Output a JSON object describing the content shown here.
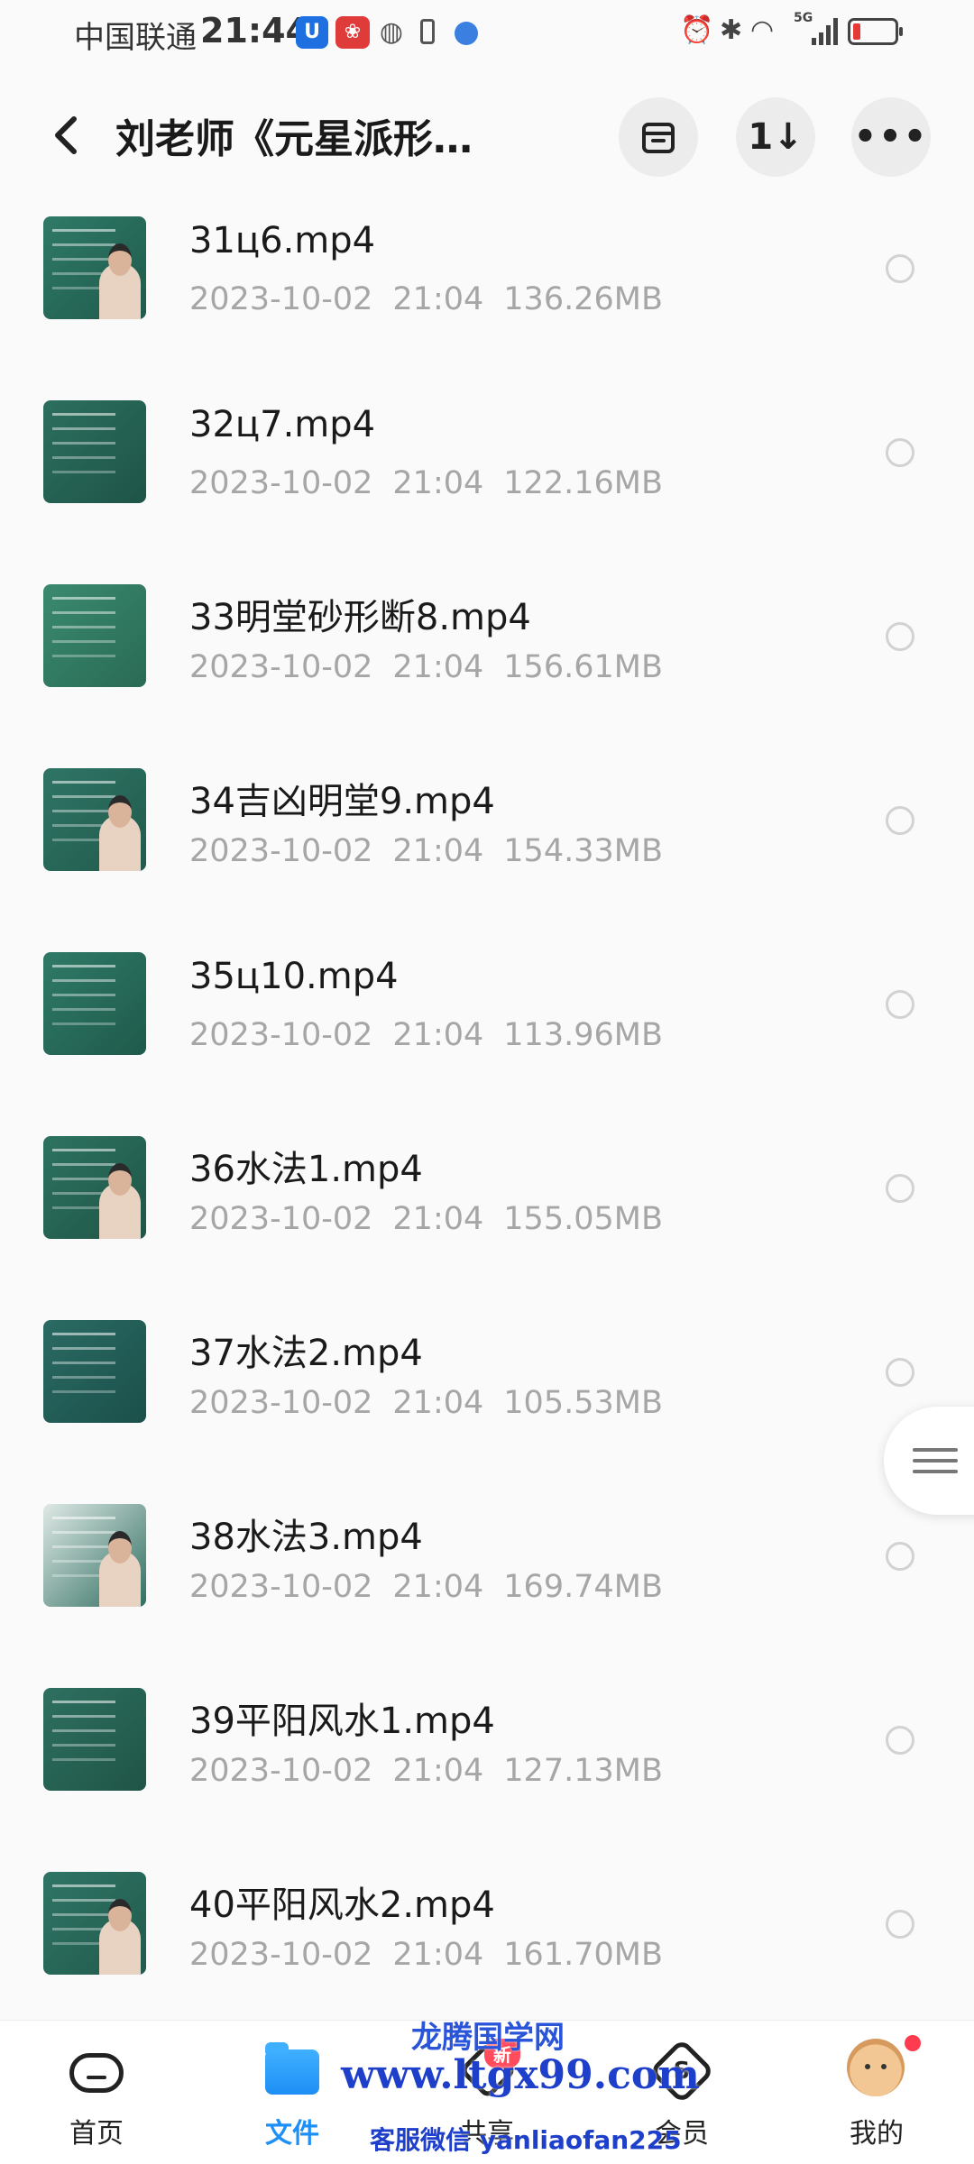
{
  "status_bar": {
    "carrier": "中国联通",
    "time": "21:44",
    "network": "5G",
    "battery_level": 0.15
  },
  "header": {
    "title": "刘老师《元星派形…",
    "back_icon": "chevron-left-icon",
    "actions": [
      "archive-icon",
      "sort-icon",
      "more-icon"
    ],
    "sort_label": "1↓",
    "more_label": "•••"
  },
  "files": [
    {
      "name": "31ц6.mp4",
      "date": "2023-10-02",
      "time": "21:04",
      "size": "136.26MB"
    },
    {
      "name": "32ц7.mp4",
      "date": "2023-10-02",
      "time": "21:04",
      "size": "122.16MB"
    },
    {
      "name": "33明堂砂形断8.mp4",
      "date": "2023-10-02",
      "time": "21:04",
      "size": "156.61MB"
    },
    {
      "name": "34吉凶明堂9.mp4",
      "date": "2023-10-02",
      "time": "21:04",
      "size": "154.33MB"
    },
    {
      "name": "35ц10.mp4",
      "date": "2023-10-02",
      "time": "21:04",
      "size": "113.96MB"
    },
    {
      "name": "36水法1.mp4",
      "date": "2023-10-02",
      "time": "21:04",
      "size": "155.05MB"
    },
    {
      "name": "37水法2.mp4",
      "date": "2023-10-02",
      "time": "21:04",
      "size": "105.53MB"
    },
    {
      "name": "38水法3.mp4",
      "date": "2023-10-02",
      "time": "21:04",
      "size": "169.74MB"
    },
    {
      "name": "39平阳风水1.mp4",
      "date": "2023-10-02",
      "time": "21:04",
      "size": "127.13MB"
    },
    {
      "name": "40平阳风水2.mp4",
      "date": "2023-10-02",
      "time": "21:04",
      "size": "161.70MB"
    }
  ],
  "bottom_nav": {
    "items": [
      {
        "label": "首页",
        "icon": "cloud-icon"
      },
      {
        "label": "文件",
        "icon": "folder-icon",
        "active": true
      },
      {
        "label": "共享",
        "icon": "share-icon"
      },
      {
        "label": "会员",
        "icon": "vip-icon"
      },
      {
        "label": "我的",
        "icon": "avatar-icon"
      }
    ],
    "share_badge": "新",
    "vip_symbol": "S"
  },
  "watermark": {
    "brand": "龙腾国学网",
    "url": "www.ltgx99.com",
    "contact": "客服微信 yanliaofan225"
  },
  "colors": {
    "accent": "#1e8ff5",
    "meta_text": "#a6a6a6",
    "background": "#fafafa",
    "watermark": "#1e3fc9"
  }
}
